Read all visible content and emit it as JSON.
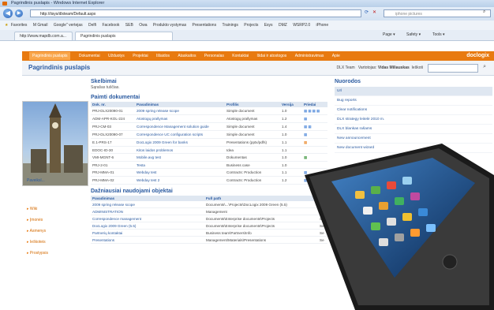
{
  "window": {
    "title": "Pagrindinis puslapis - Windows Internet Explorer"
  },
  "address": {
    "url": "http://iisys/dlxteam/Default.aspx",
    "search_placeholder": "iphone pictures"
  },
  "favorites": {
    "label": "Favorites",
    "items": [
      "M Gmail",
      "Google\" vertejas",
      "Delfi",
      "Facebook",
      "SEB",
      "Owa",
      "Produkto vystymas",
      "Presentations",
      "Trainings",
      "Projects",
      "Esys",
      "DMZ",
      "WSRP2.0",
      "iPhone"
    ]
  },
  "tabs": {
    "items": [
      "http://www.mapdb.com.a...",
      "Pagrindinis puslapis"
    ],
    "menu": [
      "Page ▾",
      "Safety ▾",
      "Tools ▾"
    ]
  },
  "site_nav": {
    "items": [
      "Pagrindinis puslapis",
      "Dokumentai",
      "Užduotys",
      "Projektai",
      "Išlaidos",
      "Ataskaitos",
      "Personalas",
      "Kontaktai",
      "Išdai ir atostogos",
      "Administravimas",
      "Apie"
    ],
    "logo": "doclogix"
  },
  "header": {
    "title": "Pagrindinis puslapis",
    "team": "DLX Team",
    "user_label": "Vartotojas:",
    "user": "Vidas Miliauskas",
    "search_label": "Ieškoti"
  },
  "left": {
    "photo_caption": "Paveiksl...",
    "links": [
      "Wiki",
      "Įmonės",
      "Asmenys",
      "Ieškoteis",
      "Prostypsis"
    ]
  },
  "main": {
    "section1": {
      "title": "Skelbimai",
      "empty_text": "Sąrašas tuščias."
    },
    "section2": {
      "title": "Paimti dokumentai",
      "columns": [
        "Dok. nr.",
        "Pavadinimas",
        "Profilis",
        "Versija",
        "Priedai"
      ],
      "rows": [
        [
          "PRJ-DLX20090-01",
          "2009 spring release scope",
          "Simple document",
          "1.0"
        ],
        [
          "ADM-APR-KOL-224",
          "Atostogų prašymas",
          "Atostogų prašymas",
          "1.2"
        ],
        [
          "PRJ-CM-03",
          "Correspondence Management solution guide",
          "Simple document",
          "1.4"
        ],
        [
          "PRJ-DLX20090-07",
          "Correspondence UC configuration scripts",
          "Simple document",
          "1.0"
        ],
        [
          "E.1-PRS-17",
          "DocLogix 2009 Green for banks",
          "Presentations (pptx/pdfs)",
          "1.1"
        ],
        [
          "EDOC-ID-30",
          "Kitos laidos problemos",
          "Idea",
          "1.1"
        ],
        [
          "VMI-MGNT-6",
          "Mobile.avg test",
          "Dokumentas",
          "1.0"
        ],
        [
          "PRJ-2-01",
          "Testa",
          "Business case",
          "1.0"
        ],
        [
          "PRJ-MMA-01",
          "Webday test",
          "Contracts: Production",
          "1.1"
        ],
        [
          "PRJ-MMA-02",
          "Webday test 2",
          "Contracts: Production",
          "1.2"
        ]
      ]
    },
    "section3": {
      "title": "Dažniausiai naudojami objektai",
      "columns": [
        "Pavadinimas",
        "Full path",
        "Pr"
      ],
      "rows": [
        [
          "2009 spring release scope",
          "Documents\\...\\Projects\\DocLogix 2009 Green (5.5)",
          "Se"
        ],
        [
          "ADMINISTRATION",
          "Management",
          "Ki"
        ],
        [
          "Correspondence management",
          "Documents\\Enterprise documents\\Projects",
          "Se"
        ],
        [
          "DocLogix 2009 Green (5.5)",
          "Documents\\Enterprise documents\\Projects",
          "Se"
        ],
        [
          "Partnerių kontaktai",
          "Business team\\Partners\\Info",
          "Se"
        ],
        [
          "Presentations",
          "Management\\Materials\\Presentations",
          "Se"
        ]
      ]
    }
  },
  "right": {
    "title": "Nuorodos",
    "links": [
      "Url",
      "Bug reports",
      "Clear notifications",
      "DLX strategy leitelė 2010 m.",
      "DLX blankas rašams",
      "New announcement",
      "New document wizard"
    ]
  },
  "colors": {
    "nav": "#e87a10",
    "link": "#2a5aa0",
    "accent": "#d46a00"
  }
}
